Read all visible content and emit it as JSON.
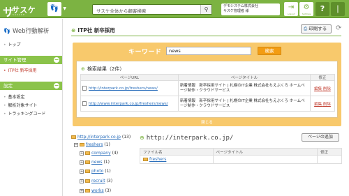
{
  "header": {
    "logo_mark": "サ",
    "logo_text": "サスケ",
    "logo_sub": "SASUKE",
    "search_placeholder": "サスケ全体から顧客検索",
    "company_name": "デモシステム株式会社",
    "user_name": "サスケ管理者 様",
    "logout_label": "Logout",
    "settings_label": "Settings",
    "help_glyph": "?",
    "colors": {
      "bar": "#7cb342",
      "accent": "#e67e22"
    }
  },
  "sidebar": {
    "title": "Web行動解析",
    "top_items": [
      {
        "label": "トップ"
      }
    ],
    "sections": [
      {
        "label": "サイト管理",
        "items": [
          {
            "label": "ITP社 新卒採用",
            "active": true
          }
        ]
      },
      {
        "label": "設定",
        "items": [
          {
            "label": "基本設定"
          },
          {
            "label": "解析対象サイト"
          },
          {
            "label": "トラッキングコード"
          }
        ]
      }
    ]
  },
  "main": {
    "page_title": "ITP社 新卒採用",
    "print_label": "印刷する",
    "keyword": {
      "label": "キーワード",
      "value": "news",
      "button_label": "検索"
    },
    "results": {
      "title": "検索結果（2件）",
      "columns": [
        "ページURL",
        "ページタイトル",
        "修正"
      ],
      "rows": [
        {
          "url": "http://interpark.co.jp/freshers/news/",
          "title": "新着情報　新卒採用サイト | 札幌のIT企業 株式会社ちえぶくろ ホームページ制作・クラウドサービス",
          "edit": "編集",
          "delete": "削除"
        },
        {
          "url": "http://www.interpark.co.jp/freshers/news/",
          "title": "新着情報　新卒採用サイト | 札幌のIT企業 株式会社ちえぶくろ ホームページ制作・クラウドサービス",
          "edit": "編集",
          "delete": "削除"
        }
      ],
      "close_label": "閉じる"
    },
    "tree": [
      {
        "label": "http://interpark.co.jp",
        "count": "(13)",
        "level": 0
      },
      {
        "label": "freshers",
        "count": "(1)",
        "level": 1
      },
      {
        "label": "company",
        "count": "(4)",
        "level": 2
      },
      {
        "label": "news",
        "count": "(1)",
        "level": 2
      },
      {
        "label": "photo",
        "count": "(1)",
        "level": 2
      },
      {
        "label": "recruit",
        "count": "(3)",
        "level": 2
      },
      {
        "label": "works",
        "count": "(3)",
        "level": 2
      }
    ],
    "directory": {
      "path": "http://interpark.co.jp/",
      "add_page_label": "ページの追加",
      "columns": [
        "ファイル名",
        "ページタイトル",
        "修正"
      ],
      "rows": [
        {
          "name": "freshers"
        }
      ]
    }
  }
}
